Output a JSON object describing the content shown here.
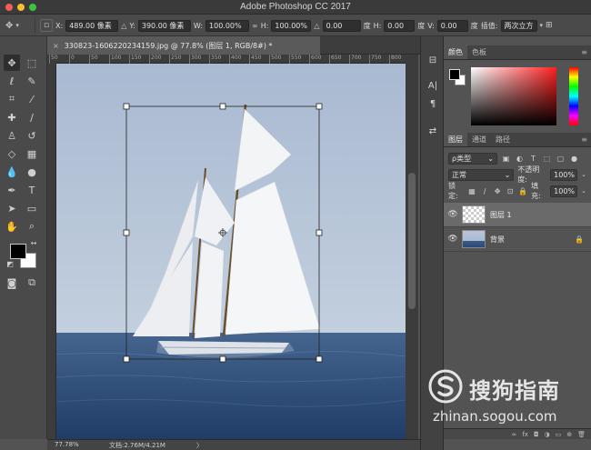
{
  "window": {
    "title": "Adobe Photoshop CC 2017"
  },
  "options": {
    "x_label": "X:",
    "x_value": "489.00 像素",
    "y_label": "Y:",
    "y_value": "390.00 像素",
    "w_label": "W:",
    "w_value": "100.00%",
    "h_label": "H:",
    "h_value": "100.00%",
    "rot_value": "0.00",
    "deg1": "度",
    "hskew_label": "H:",
    "hskew_value": "0.00",
    "deg2": "度",
    "vskew_label": "V:",
    "vskew_value": "0.00",
    "deg3": "度",
    "interp_label": "插值:",
    "interp_value": "两次立方"
  },
  "document": {
    "tab_title": "330823-16062202341​59.jpg @ 77.8% (图层 1, RGB/8#) *",
    "close_glyph": "×"
  },
  "ruler": {
    "h_ticks": [
      "50",
      "0",
      "50",
      "100",
      "150",
      "200",
      "250",
      "300",
      "350",
      "400",
      "450",
      "500",
      "550",
      "600",
      "650",
      "700",
      "750",
      "800"
    ]
  },
  "status": {
    "zoom": "77.78%",
    "doc": "文档:2.76M/4.21M",
    "arrow": "〉"
  },
  "color_panel": {
    "tab_color": "颜色",
    "tab_swatches": "色板",
    "accent_hue": "#ff1f1f"
  },
  "layers_panel": {
    "tab_layers": "图层",
    "tab_channels": "通道",
    "tab_paths": "路径",
    "filter_kind": "ρ类型",
    "blend_mode": "正常",
    "opacity_label": "不透明度:",
    "opacity_value": "100%",
    "lock_label": "锁定:",
    "fill_label": "填充:",
    "fill_value": "100%",
    "layers": [
      {
        "name": "图层 1",
        "selected": true
      },
      {
        "name": "背景",
        "selected": false
      }
    ],
    "footer_icons": [
      "link-icon",
      "fx-icon",
      "mask-icon",
      "adjust-icon",
      "folder-icon",
      "new-layer-icon",
      "trash-icon"
    ],
    "footer_glyphs": [
      "∞",
      "fx",
      "◘",
      "◑",
      "▭",
      "⊕",
      "🗑"
    ]
  },
  "watermark": {
    "brand": "搜狗指南",
    "url": "zhinan.sogou.com"
  }
}
